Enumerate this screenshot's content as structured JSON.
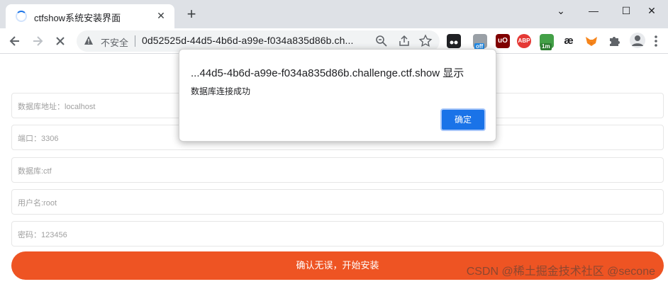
{
  "browser": {
    "tab_title": "ctfshow系统安装界面",
    "tab_close": "✕",
    "new_tab": "+",
    "window_controls": [
      "⌄",
      "—",
      "☐",
      "✕"
    ],
    "security_label": "不安全",
    "url": "0d52525d-44d5-4b6d-a99e-f034a835d86b.ch...",
    "extensions": [
      {
        "name": "tampermonkey-icon",
        "glyph": "◉",
        "color": "#202124"
      },
      {
        "name": "ext-off-icon",
        "glyph": "⚑",
        "color": "#5f6368",
        "badge": "off",
        "badge_color": "#1e88e5"
      },
      {
        "name": "ublock-icon",
        "glyph": "uO",
        "color": "#800000"
      },
      {
        "name": "adblock-icon",
        "glyph": "ABP",
        "color": "#e53935"
      },
      {
        "name": "ext-green-icon",
        "glyph": "⬆",
        "color": "#2e7d32",
        "badge": "1m",
        "badge_color": "#2e7d32"
      },
      {
        "name": "ae-icon",
        "glyph": "æ",
        "color": "#202124"
      },
      {
        "name": "metamask-icon",
        "glyph": "🦊",
        "color": "#f6851b"
      },
      {
        "name": "puzzle-icon",
        "glyph": "✚",
        "color": "#5f6368"
      }
    ]
  },
  "form": {
    "db_host": "数据库地址：localhost",
    "port": "端口：3306",
    "db_name": "数据库:ctf",
    "username": "用户名:root",
    "password": "密码：123456",
    "submit_label": "确认无误，开始安装"
  },
  "dialog": {
    "title": "...44d5-4b6d-a99e-f034a835d86b.challenge.ctf.show 显示",
    "message": "数据库连接成功",
    "ok_label": "确定"
  },
  "watermark": "CSDN @稀土掘金技术社区 @secone"
}
